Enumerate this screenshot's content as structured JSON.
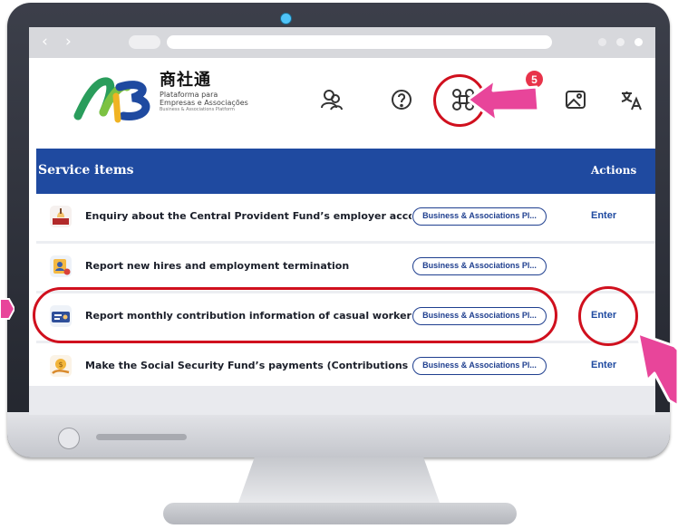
{
  "colors": {
    "brand_blue": "#1f4aa0",
    "highlight_red": "#d0101e",
    "arrow_pink": "#e8459a",
    "badge_red": "#e8334a"
  },
  "browser": {
    "back_icon": "chevron-left-icon",
    "forward_icon": "chevron-right-icon",
    "back_glyph": "‹",
    "forward_glyph": "›"
  },
  "header": {
    "logo": {
      "cn": "商社通",
      "line_pt_1": "Plataforma para",
      "line_pt_2": "Empresas e Associações",
      "line_en": "Business & Associations Platform"
    },
    "icons": [
      "user-switch-icon",
      "help-icon",
      "apps-command-icon",
      "notification-icon",
      "image-icon",
      "translate-icon"
    ],
    "notification_count": "5"
  },
  "table": {
    "header_service": "Service items",
    "header_actions": "Actions",
    "rows": [
      {
        "title": "Enquiry about the Central Provident Fund’s employer account",
        "platform": "Business & Associations Pl...",
        "action": "Enter",
        "icon": "cpf-account-icon"
      },
      {
        "title": "Report new hires and employment termination",
        "platform": "Business & Associations Pl...",
        "action": "",
        "icon": "employment-report-icon"
      },
      {
        "title": "Report monthly contribution information of casual workers",
        "platform": "Business & Associations Pl...",
        "action": "Enter",
        "icon": "contribution-report-icon"
      },
      {
        "title": "Make the Social Security Fund’s payments (Contributions of t...",
        "platform": "Business & Associations Pl...",
        "action": "Enter",
        "icon": "ssf-payment-icon"
      }
    ]
  }
}
